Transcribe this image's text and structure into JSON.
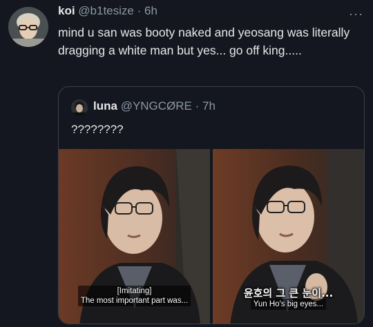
{
  "tweet": {
    "author_name": "koi",
    "handle": "@b1tesize",
    "time": "6h",
    "more": "···",
    "text": "mind u san was booty naked and yeosang was literally dragging a white man but yes... go off king....."
  },
  "quote": {
    "author_name": "luna",
    "handle": "@YNGCØRE",
    "time": "7h",
    "text": "????????",
    "media": [
      {
        "caption_line1": "[Imitating]",
        "caption_line2": "The most important part was..."
      },
      {
        "korean": "윤호의 그 큰 눈이...",
        "caption_line1": "Yun Ho's big eyes..."
      }
    ]
  },
  "colors": {
    "background": "#14171f",
    "text": "#e7e9ea",
    "muted": "#8b98a5",
    "border": "#3c4146"
  },
  "icons": [
    "avatar",
    "more-icon",
    "quote-avatar"
  ]
}
